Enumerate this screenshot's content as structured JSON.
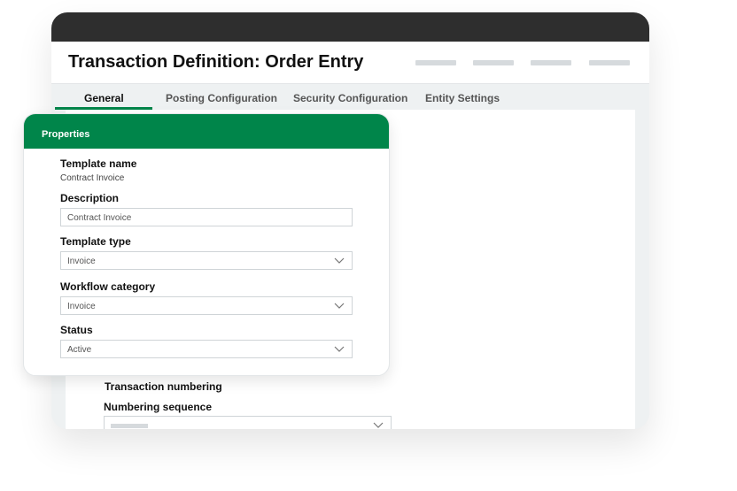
{
  "header": {
    "title": "Transaction Definition: Order Entry"
  },
  "tabs": [
    {
      "label": "General"
    },
    {
      "label": "Posting Configuration"
    },
    {
      "label": "Security Configuration"
    },
    {
      "label": "Entity Settings"
    }
  ],
  "panel": {
    "title": "Properties",
    "fields": {
      "template_name": {
        "label": "Template name",
        "value": "Contract Invoice"
      },
      "description": {
        "label": "Description",
        "value": "Contract Invoice"
      },
      "template_type": {
        "label": "Template type",
        "value": "Invoice"
      },
      "workflow_category": {
        "label": "Workflow category",
        "value": "Invoice"
      },
      "status": {
        "label": "Status",
        "value": "Active"
      }
    }
  },
  "lower": {
    "heading": "Transaction numbering",
    "numbering_label": "Numbering sequence"
  },
  "colors": {
    "accent": "#00854a",
    "titlebar": "#2e2e2e"
  }
}
